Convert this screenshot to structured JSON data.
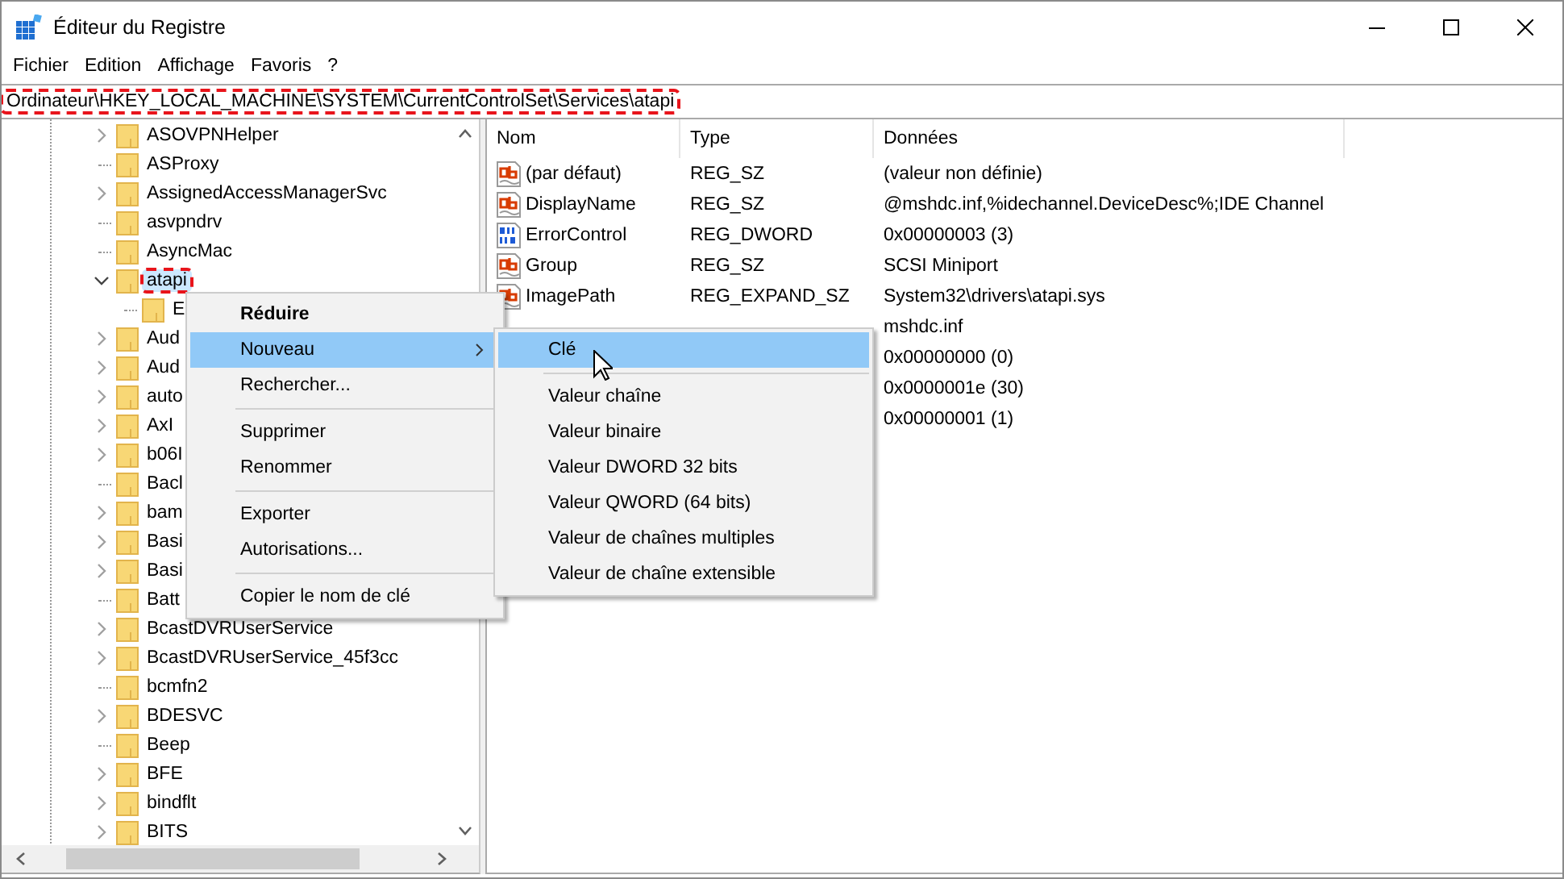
{
  "window": {
    "title": "Éditeur du Registre"
  },
  "menu": [
    "Fichier",
    "Edition",
    "Affichage",
    "Favoris",
    "?"
  ],
  "address": {
    "value": "Ordinateur\\HKEY_LOCAL_MACHINE\\SYSTEM\\CurrentControlSet\\Services\\atapi",
    "highlighted": true
  },
  "tree": [
    {
      "label": "ASOVPNHelper",
      "kind": "branch",
      "expanded": false,
      "selected": false,
      "highlighted": false
    },
    {
      "label": "ASProxy",
      "kind": "leaf",
      "selected": false,
      "highlighted": false
    },
    {
      "label": "AssignedAccessManagerSvc",
      "kind": "branch",
      "expanded": false,
      "selected": false,
      "highlighted": false
    },
    {
      "label": "asvpndrv",
      "kind": "leaf",
      "selected": false,
      "highlighted": false
    },
    {
      "label": "AsyncMac",
      "kind": "leaf",
      "selected": false,
      "highlighted": false
    },
    {
      "label": "atapi",
      "kind": "branch",
      "expanded": true,
      "selected": true,
      "highlighted": true,
      "children": [
        {
          "label": "E",
          "kind": "leaf",
          "selected": false,
          "highlighted": false
        }
      ]
    },
    {
      "label": "Aud",
      "kind": "branch",
      "expanded": false,
      "selected": false,
      "highlighted": false
    },
    {
      "label": "Aud",
      "kind": "branch",
      "expanded": false,
      "selected": false,
      "highlighted": false
    },
    {
      "label": "auto",
      "kind": "branch",
      "expanded": false,
      "selected": false,
      "highlighted": false
    },
    {
      "label": "AxI",
      "kind": "branch",
      "expanded": false,
      "selected": false,
      "highlighted": false
    },
    {
      "label": "b06I",
      "kind": "branch",
      "expanded": false,
      "selected": false,
      "highlighted": false
    },
    {
      "label": "Bacl",
      "kind": "leaf",
      "selected": false,
      "highlighted": false
    },
    {
      "label": "bam",
      "kind": "branch",
      "expanded": false,
      "selected": false,
      "highlighted": false
    },
    {
      "label": "Basi",
      "kind": "branch",
      "expanded": false,
      "selected": false,
      "highlighted": false
    },
    {
      "label": "Basi",
      "kind": "branch",
      "expanded": false,
      "selected": false,
      "highlighted": false
    },
    {
      "label": "Batt",
      "kind": "leaf",
      "selected": false,
      "highlighted": false
    },
    {
      "label": "BcastDVRUserService",
      "kind": "branch",
      "expanded": false,
      "selected": false,
      "highlighted": false
    },
    {
      "label": "BcastDVRUserService_45f3cc",
      "kind": "branch",
      "expanded": false,
      "selected": false,
      "highlighted": false
    },
    {
      "label": "bcmfn2",
      "kind": "leaf",
      "selected": false,
      "highlighted": false
    },
    {
      "label": "BDESVC",
      "kind": "branch",
      "expanded": false,
      "selected": false,
      "highlighted": false
    },
    {
      "label": "Beep",
      "kind": "leaf",
      "selected": false,
      "highlighted": false
    },
    {
      "label": "BFE",
      "kind": "branch",
      "expanded": false,
      "selected": false,
      "highlighted": false
    },
    {
      "label": "bindflt",
      "kind": "branch",
      "expanded": false,
      "selected": false,
      "highlighted": false
    },
    {
      "label": "BITS",
      "kind": "branch",
      "expanded": false,
      "selected": false,
      "highlighted": false
    }
  ],
  "table": {
    "columns": [
      "Nom",
      "Type",
      "Données"
    ],
    "rows": [
      {
        "kind": "string",
        "name": "(par défaut)",
        "type": "REG_SZ",
        "data": "(valeur non définie)"
      },
      {
        "kind": "string",
        "name": "DisplayName",
        "type": "REG_SZ",
        "data": "@mshdc.inf,%idechannel.DeviceDesc%;IDE Channel"
      },
      {
        "kind": "binary",
        "name": "ErrorControl",
        "type": "REG_DWORD",
        "data": "0x00000003 (3)"
      },
      {
        "kind": "string",
        "name": "Group",
        "type": "REG_SZ",
        "data": "SCSI Miniport"
      },
      {
        "kind": "string",
        "name": "ImagePath",
        "type": "REG_EXPAND_SZ",
        "data": "System32\\drivers\\atapi.sys"
      },
      {
        "data": "mshdc.inf"
      },
      {
        "data": "0x00000000 (0)"
      },
      {
        "data": "0x0000001e (30)"
      },
      {
        "data": "0x00000001 (1)"
      }
    ]
  },
  "context_menu": [
    {
      "kind": "item",
      "label": "Réduire",
      "default": true,
      "selected": false,
      "submenu": false
    },
    {
      "kind": "item",
      "label": "Nouveau",
      "default": false,
      "selected": true,
      "submenu": true
    },
    {
      "kind": "item",
      "label": "Rechercher...",
      "default": false,
      "selected": false,
      "submenu": false
    },
    {
      "kind": "separator"
    },
    {
      "kind": "item",
      "label": "Supprimer",
      "default": false,
      "selected": false,
      "submenu": false
    },
    {
      "kind": "item",
      "label": "Renommer",
      "default": false,
      "selected": false,
      "submenu": false
    },
    {
      "kind": "separator"
    },
    {
      "kind": "item",
      "label": "Exporter",
      "default": false,
      "selected": false,
      "submenu": false
    },
    {
      "kind": "item",
      "label": "Autorisations...",
      "default": false,
      "selected": false,
      "submenu": false
    },
    {
      "kind": "separator"
    },
    {
      "kind": "item",
      "label": "Copier le nom de clé",
      "default": false,
      "selected": false,
      "submenu": false
    }
  ],
  "submenu": [
    {
      "kind": "item",
      "label": "Clé",
      "default": false,
      "selected": true,
      "submenu": false
    },
    {
      "kind": "separator"
    },
    {
      "kind": "item",
      "label": "Valeur chaîne",
      "default": false,
      "selected": false,
      "submenu": false
    },
    {
      "kind": "item",
      "label": "Valeur binaire",
      "default": false,
      "selected": false,
      "submenu": false
    },
    {
      "kind": "item",
      "label": "Valeur DWORD 32 bits",
      "default": false,
      "selected": false,
      "submenu": false
    },
    {
      "kind": "item",
      "label": "Valeur QWORD (64 bits)",
      "default": false,
      "selected": false,
      "submenu": false
    },
    {
      "kind": "item",
      "label": "Valeur de chaînes multiples",
      "default": false,
      "selected": false,
      "submenu": false
    },
    {
      "kind": "item",
      "label": "Valeur de chaîne extensible",
      "default": false,
      "selected": false,
      "submenu": false
    }
  ]
}
